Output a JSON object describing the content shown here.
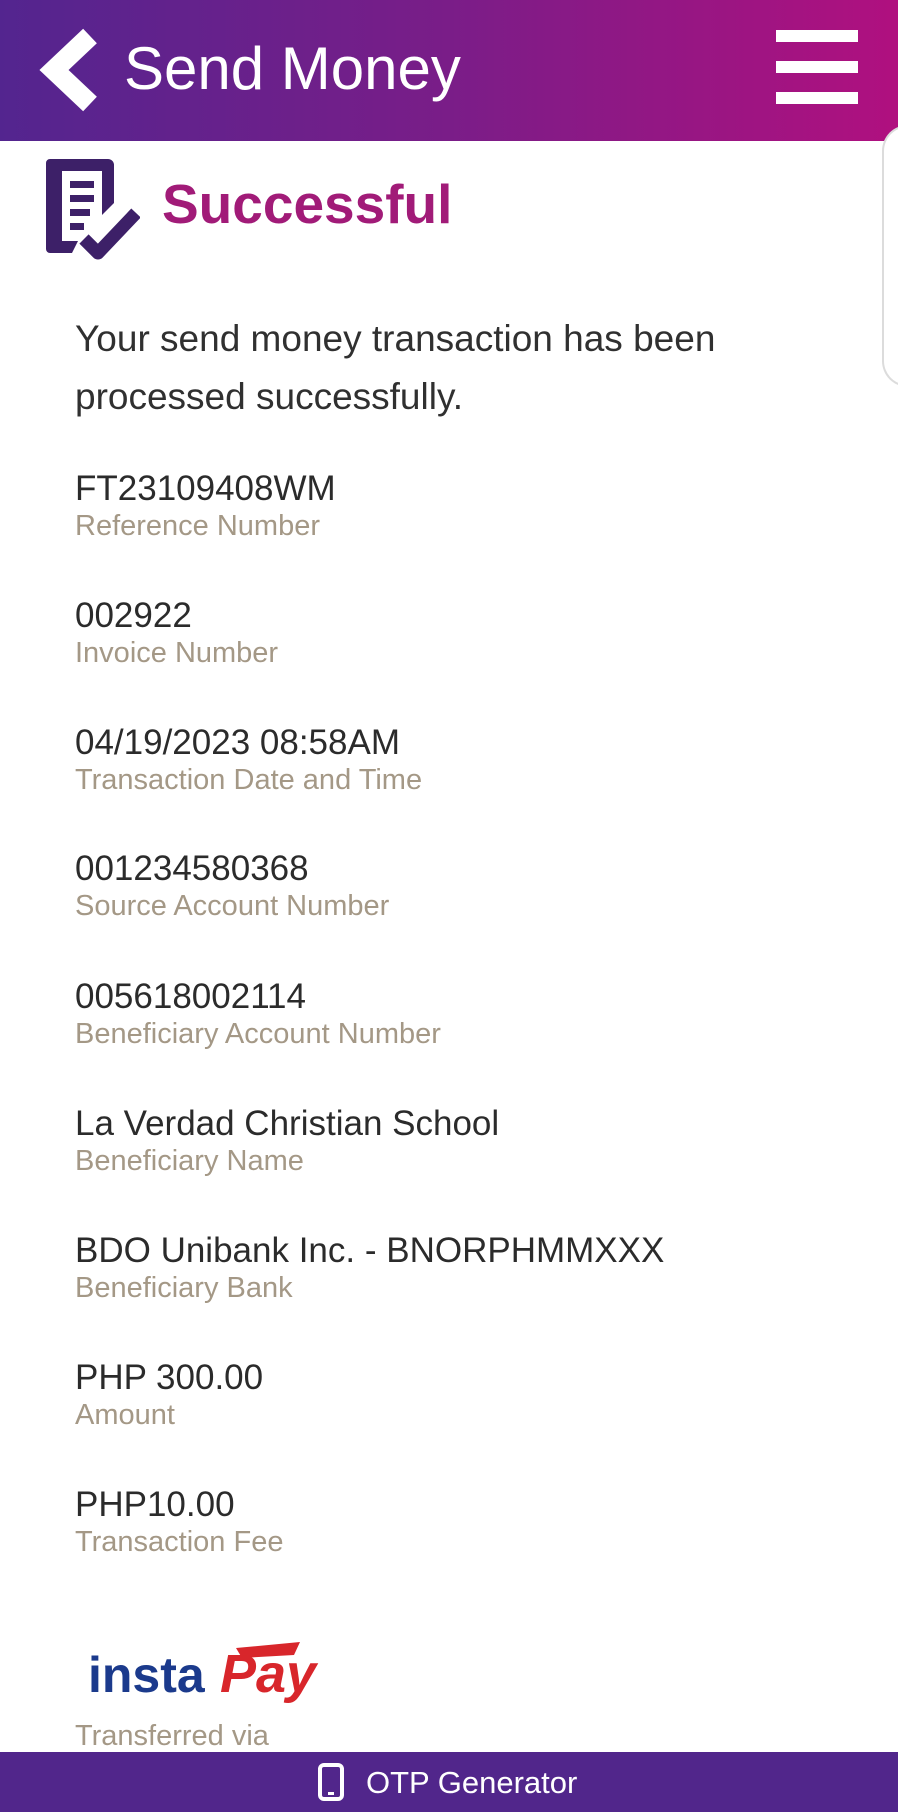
{
  "header": {
    "title": "Send Money",
    "back_icon": "chevron-left-icon",
    "menu_icon": "hamburger-menu-icon"
  },
  "status": {
    "icon": "document-check-icon",
    "title": "Successful",
    "message": "Your send money transaction has been processed successfully."
  },
  "details": [
    {
      "value": "FT23109408WM",
      "label": "Reference Number"
    },
    {
      "value": "002922",
      "label": "Invoice Number"
    },
    {
      "value": "04/19/2023 08:58AM",
      "label": "Transaction Date and Time"
    },
    {
      "value": "001234580368",
      "label": "Source Account Number"
    },
    {
      "value": "005618002114",
      "label": "Beneficiary Account Number"
    },
    {
      "value": "La Verdad Christian School",
      "label": "Beneficiary Name"
    },
    {
      "value": "BDO Unibank Inc. - BNORPHMMXXX",
      "label": "Beneficiary Bank"
    },
    {
      "value": "PHP 300.00",
      "label": "Amount"
    },
    {
      "value": "PHP10.00",
      "label": "Transaction Fee"
    }
  ],
  "transfer": {
    "logo_text_left": "insta",
    "logo_text_right": "Pay",
    "label": "Transferred via"
  },
  "footer": {
    "icon": "mobile-phone-icon",
    "label": "OTP Generator"
  },
  "colors": {
    "header_start": "#53258f",
    "header_end": "#b0107f",
    "success_title": "#a11b78",
    "status_icon": "#3d2068",
    "label_gray": "#a49886",
    "footer_bg": "#51268b",
    "instapay_blue": "#1b3a8c",
    "instapay_red": "#d8262b"
  }
}
